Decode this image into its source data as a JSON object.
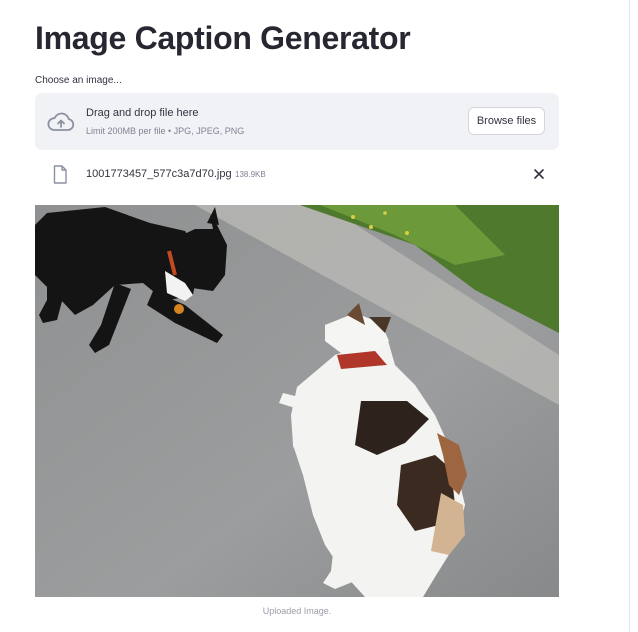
{
  "page": {
    "title": "Image Caption Generator"
  },
  "uploader": {
    "label": "Choose an image...",
    "drop_title": "Drag and drop file here",
    "drop_limit": "Limit 200MB per file • JPG, JPEG, PNG",
    "browse_label": "Browse files",
    "upload_icon": "cloud-upload-icon"
  },
  "file": {
    "name": "1001773457_577c3a7d70.jpg",
    "size": "138.9KB",
    "file_icon": "file-icon",
    "remove_icon": "close-icon"
  },
  "image": {
    "caption": "Uploaded Image."
  },
  "colors": {
    "dropzone_bg": "#f0f2f6",
    "title_text": "#262730",
    "muted_text": "#808495"
  }
}
